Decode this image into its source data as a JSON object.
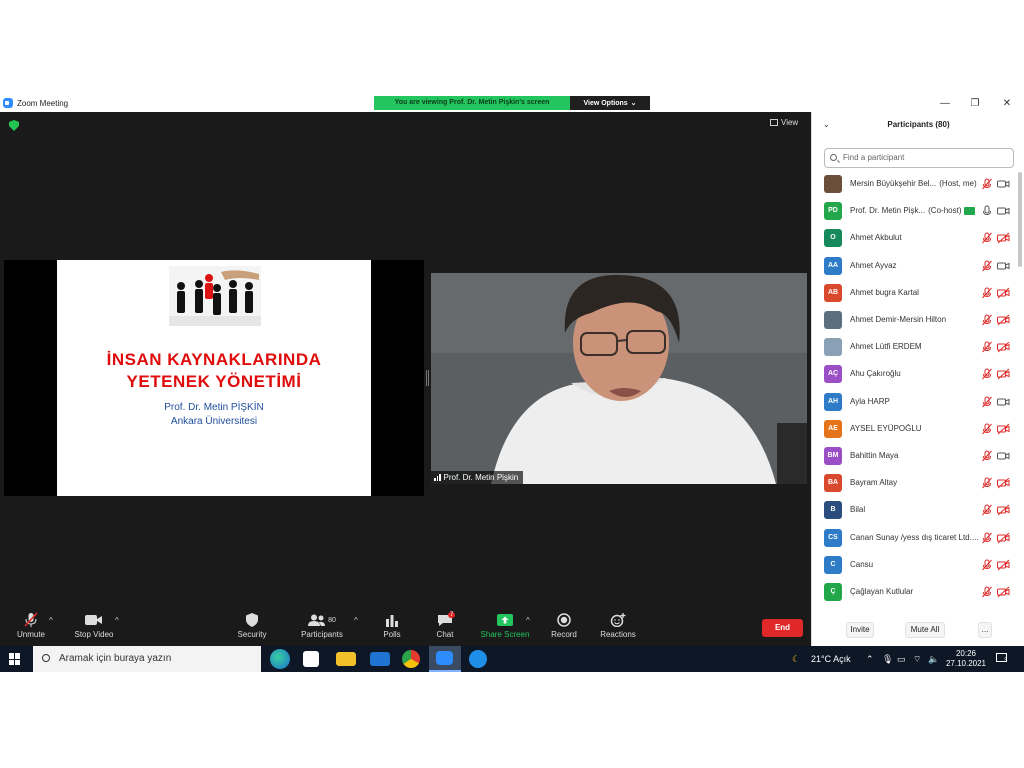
{
  "window": {
    "title": "Zoom Meeting",
    "minimize": "—",
    "maximize": "❐",
    "close": "✕"
  },
  "banner": {
    "viewing": "You are viewing Prof. Dr. Metin Pişkin's screen",
    "view_options": "View Options",
    "view_options_caret": "⌄"
  },
  "meeting": {
    "view_label": "View"
  },
  "slide": {
    "title_line1": "İNSAN KAYNAKLARINDA",
    "title_line2": "YETENEK YÖNETİMİ",
    "author": "Prof. Dr. Metin PİŞKİN",
    "university": "Ankara Üniversitesi"
  },
  "video": {
    "name": "Prof. Dr. Metin Pişkin"
  },
  "toolbar": {
    "unmute": "Unmute",
    "stop_video": "Stop Video",
    "security": "Security",
    "participants": "Participants",
    "participants_count": "80",
    "polls": "Polls",
    "chat": "Chat",
    "chat_badge": "7",
    "share_screen": "Share Screen",
    "record": "Record",
    "reactions": "Reactions",
    "end": "End",
    "caret": "^"
  },
  "panel": {
    "title": "Participants (80)",
    "collapse": "⌄",
    "search_placeholder": "Find a participant",
    "invite": "Invite",
    "mute_all": "Mute All",
    "more": "..."
  },
  "participants": [
    {
      "initials": "",
      "name": "Mersin Büyükşehir Bel...",
      "role": "(Host, me)",
      "color": "#6b4f3a",
      "mic": "muted",
      "cam": "on"
    },
    {
      "initials": "PD",
      "name": "Prof. Dr. Metin Pişk...",
      "role": "(Co-host)",
      "color": "#22a84a",
      "mic": "on",
      "cam": "on",
      "sharing": true
    },
    {
      "initials": "O",
      "name": "Ahmet Akbulut",
      "role": "",
      "color": "#168a5a",
      "mic": "muted",
      "cam": "off"
    },
    {
      "initials": "AA",
      "name": "Ahmet Ayvaz",
      "role": "",
      "color": "#2e7cc7",
      "mic": "muted",
      "cam": "on"
    },
    {
      "initials": "AB",
      "name": "Ahmet bugra Kartal",
      "role": "",
      "color": "#d9492d",
      "mic": "muted",
      "cam": "off"
    },
    {
      "initials": "",
      "name": "Ahmet Demir-Mersin Hilton",
      "role": "",
      "color": "#5a7080",
      "mic": "muted",
      "cam": "off"
    },
    {
      "initials": "",
      "name": "Ahmet Lütfi ERDEM",
      "role": "",
      "color": "#8aa0b5",
      "mic": "muted",
      "cam": "off"
    },
    {
      "initials": "AÇ",
      "name": "Ahu Çakıroğlu",
      "role": "",
      "color": "#9b4fc7",
      "mic": "muted",
      "cam": "off"
    },
    {
      "initials": "AH",
      "name": "Ayla HARP",
      "role": "",
      "color": "#2e7cc7",
      "mic": "muted",
      "cam": "on"
    },
    {
      "initials": "AE",
      "name": "AYSEL EYÜPOĞLU",
      "role": "",
      "color": "#e5731a",
      "mic": "muted",
      "cam": "off"
    },
    {
      "initials": "BM",
      "name": "Bahittin Maya",
      "role": "",
      "color": "#9b4fc7",
      "mic": "muted",
      "cam": "on"
    },
    {
      "initials": "BA",
      "name": "Bayram Altay",
      "role": "",
      "color": "#d9492d",
      "mic": "muted",
      "cam": "off"
    },
    {
      "initials": "B",
      "name": "Bilal",
      "role": "",
      "color": "#2b4d7d",
      "mic": "muted",
      "cam": "off"
    },
    {
      "initials": "CS",
      "name": "Canan Sunay /yess dış ticaret Ltd....",
      "role": "",
      "color": "#2e7cc7",
      "mic": "muted",
      "cam": "off"
    },
    {
      "initials": "C",
      "name": "Cansu",
      "role": "",
      "color": "#2e7cc7",
      "mic": "muted",
      "cam": "off"
    },
    {
      "initials": "Ç",
      "name": "Çağlayan Kutlular",
      "role": "",
      "color": "#22a84a",
      "mic": "muted",
      "cam": "off"
    }
  ],
  "taskbar": {
    "search_placeholder": "Aramak için buraya yazın",
    "weather": "21°C  Açık",
    "time": "20:26",
    "date": "27.10.2021",
    "notif_count": "3"
  }
}
